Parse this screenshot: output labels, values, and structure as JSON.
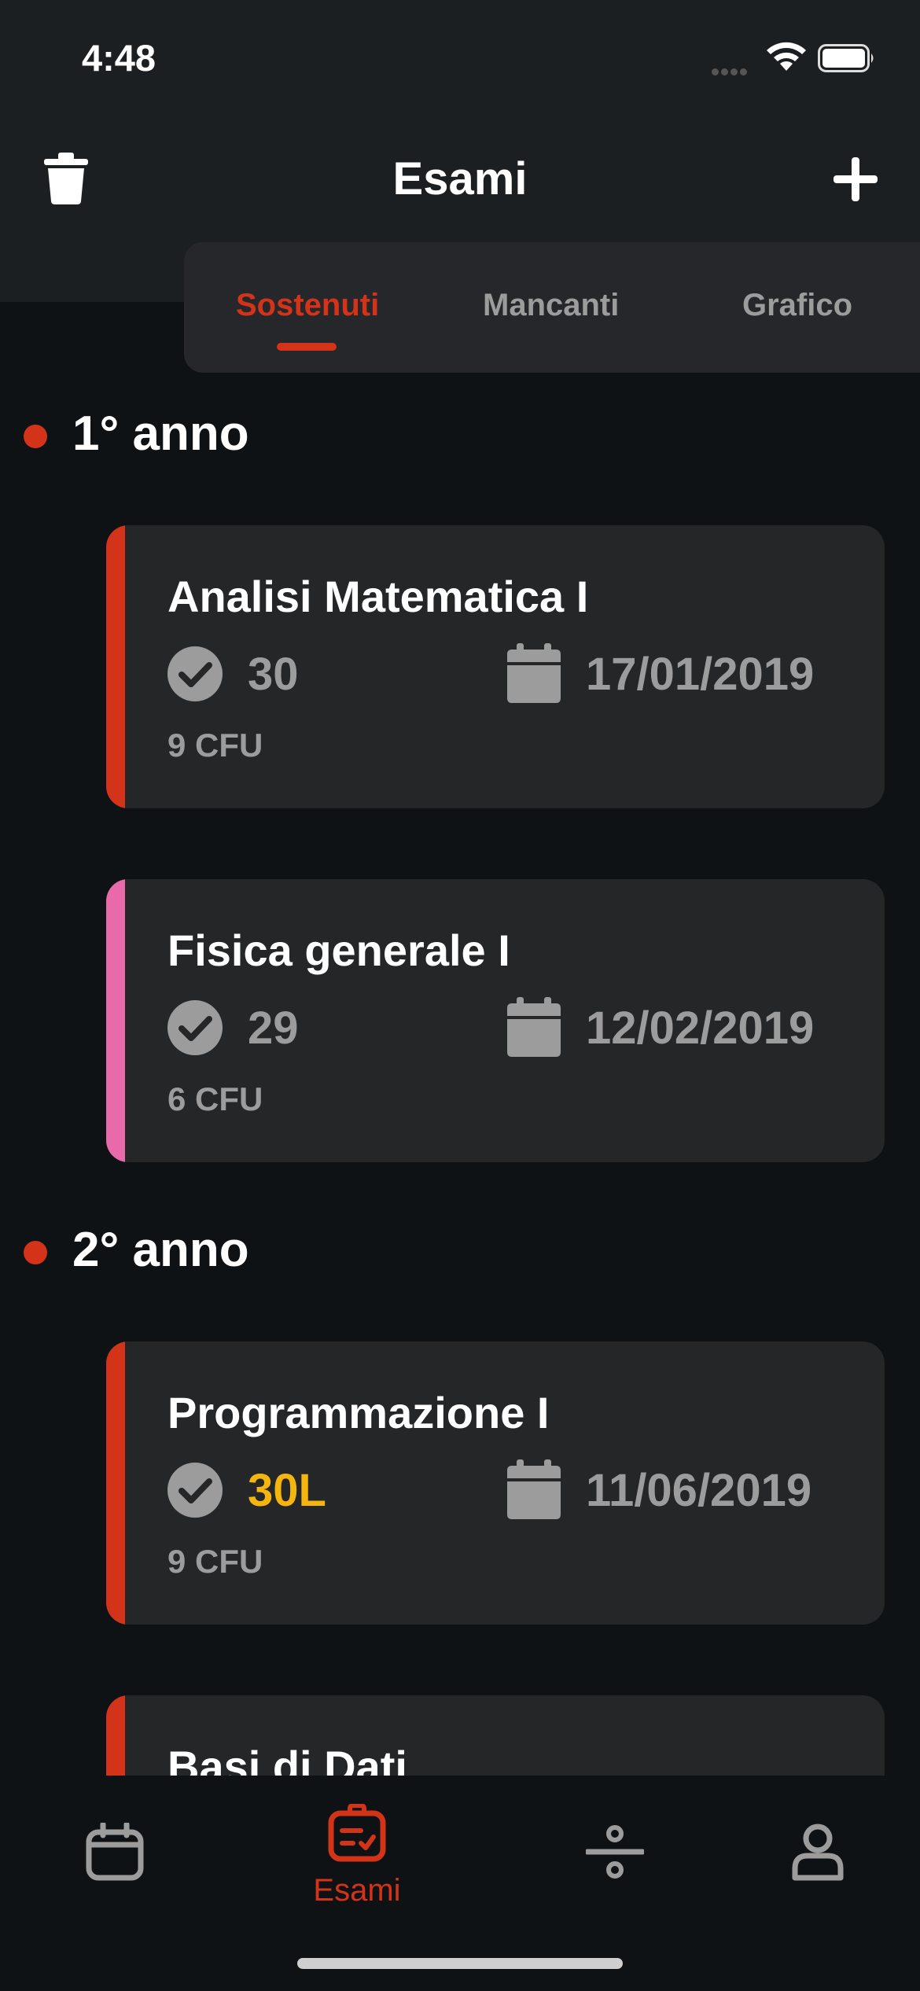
{
  "status_bar": {
    "time": "4:48"
  },
  "nav": {
    "title": "Esami"
  },
  "tabs": [
    {
      "label": "Sostenuti",
      "active": true
    },
    {
      "label": "Mancanti",
      "active": false
    },
    {
      "label": "Grafico",
      "active": false
    }
  ],
  "years": [
    {
      "label": "1° anno",
      "exams": [
        {
          "title": "Analisi Matematica I",
          "grade": "30",
          "date": "17/01/2019",
          "cfu": "9  CFU",
          "color": "#d33319"
        },
        {
          "title": "Fisica generale I",
          "grade": "29",
          "date": "12/02/2019",
          "cfu": "6  CFU",
          "color": "#e86aab"
        }
      ]
    },
    {
      "label": "2° anno",
      "exams": [
        {
          "title": "Programmazione I",
          "grade": "30L",
          "date": "11/06/2019",
          "cfu": "9  CFU",
          "color": "#d33319"
        },
        {
          "title": "Basi di Dati",
          "color": "#d33319"
        }
      ]
    }
  ],
  "tab_bar": {
    "items": [
      {
        "icon": "calendar-icon"
      },
      {
        "icon": "exams-icon",
        "label": "Esami",
        "active": true
      },
      {
        "icon": "divide-icon"
      },
      {
        "icon": "profile-icon"
      }
    ]
  },
  "colors": {
    "accent": "#d33319",
    "lode": "#f5b50f",
    "card_bg": "#252628",
    "muted": "#9c9c9c"
  }
}
